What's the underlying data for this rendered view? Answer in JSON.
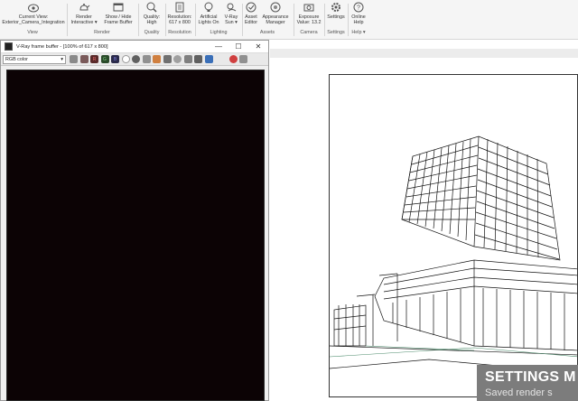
{
  "ribbon": {
    "buttons": [
      {
        "id": "current-view",
        "lines": [
          "Current View:",
          "Exterior_Camera_Integration"
        ],
        "icon": "camera-view-icon"
      },
      {
        "id": "render",
        "lines": [
          "Render",
          "Interactive ▾"
        ],
        "icon": "teapot-render-icon"
      },
      {
        "id": "show-hide-fb",
        "lines": [
          "Show / Hide",
          "Frame Buffer"
        ],
        "icon": "frame-buffer-icon"
      },
      {
        "id": "quality",
        "lines": [
          "Quality:",
          "High"
        ],
        "icon": "quality-icon"
      },
      {
        "id": "resolution",
        "lines": [
          "Resolution:",
          "617 x 800"
        ],
        "icon": "resolution-icon"
      },
      {
        "id": "artificial-lights",
        "lines": [
          "Artificial",
          "Lights On"
        ],
        "icon": "bulb-icon"
      },
      {
        "id": "vray-sun",
        "lines": [
          "V-Ray",
          "Sun ▾"
        ],
        "icon": "sun-icon"
      },
      {
        "id": "asset-editor",
        "lines": [
          "Asset",
          "Editor"
        ],
        "icon": "asset-editor-icon"
      },
      {
        "id": "appearance-manager",
        "lines": [
          "Appearance",
          "Manager"
        ],
        "icon": "appearance-icon"
      },
      {
        "id": "exposure",
        "lines": [
          "Exposure",
          "Value: 13.2"
        ],
        "icon": "exposure-icon"
      },
      {
        "id": "settings",
        "lines": [
          "Settings",
          ""
        ],
        "icon": "gear-icon"
      },
      {
        "id": "online-help",
        "lines": [
          "Online",
          "Help"
        ],
        "icon": "help-icon"
      }
    ],
    "groups": [
      "View",
      "Render",
      "Quality",
      "Resolution",
      "Lighting",
      "Assets",
      "Camera",
      "Settings",
      "Help ▾"
    ]
  },
  "vfb": {
    "title": "V-Ray frame buffer - [100% of 617 x 800]",
    "channel": "RGB color",
    "window_controls": [
      "—",
      "☐",
      "✕"
    ],
    "channel_buttons": [
      "R",
      "G",
      "B"
    ]
  },
  "toast": {
    "title": "SETTINGS M",
    "subtitle": "Saved render s"
  },
  "colors": {
    "render_bg": "#0c0305",
    "ribbon_bg": "#f5f5f5",
    "toast_bg": "#7c7c7c"
  }
}
